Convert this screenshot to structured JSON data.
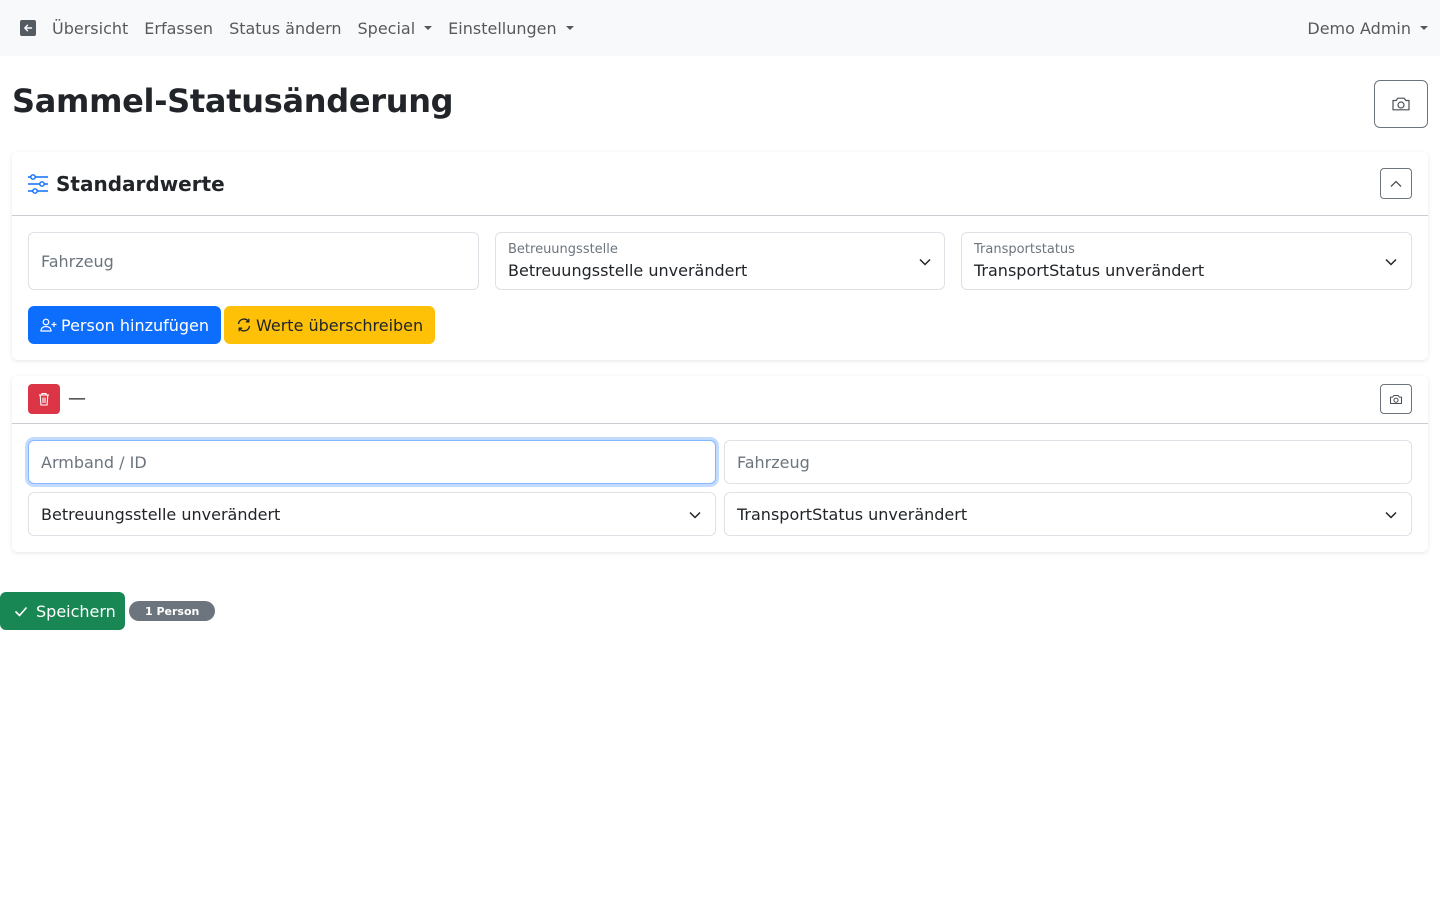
{
  "navbar": {
    "items": [
      {
        "label": "Übersicht"
      },
      {
        "label": "Erfassen"
      },
      {
        "label": "Status ändern"
      },
      {
        "label": "Special"
      },
      {
        "label": "Einstellungen"
      }
    ],
    "user": "Demo Admin"
  },
  "page": {
    "title": "Sammel-Statusänderung"
  },
  "defaults": {
    "title": "Standardwerte",
    "vehicle_placeholder": "Fahrzeug",
    "care_station_label": "Betreuungsstelle",
    "care_station_value": "Betreuungsstelle unverändert",
    "transport_label": "Transportstatus",
    "transport_value": "TransportStatus unverändert",
    "add_person_label": "Person hinzufügen",
    "overwrite_label": "Werte überschreiben"
  },
  "entry": {
    "header_text": "—",
    "wristband_placeholder": "Armband / ID",
    "vehicle_placeholder": "Fahrzeug",
    "care_station_value": "Betreuungsstelle unverändert",
    "transport_value": "TransportStatus unverändert"
  },
  "footer": {
    "save_label": "Speichern",
    "count_badge": "1 Person"
  },
  "colors": {
    "primary": "#0d6efd",
    "warning": "#ffc107",
    "danger": "#dc3545",
    "success": "#198754",
    "secondary": "#6c757d"
  }
}
